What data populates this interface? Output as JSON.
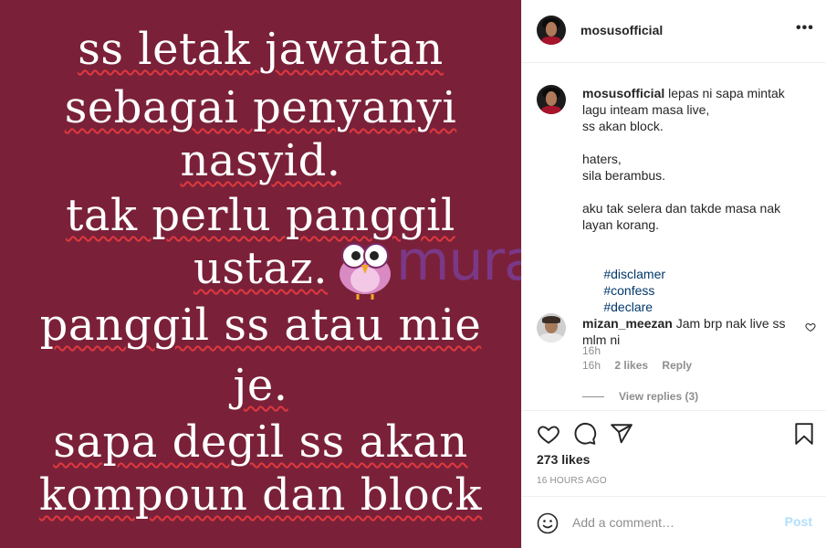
{
  "image": {
    "lines": [
      "ss letak jawatan",
      "sebagai penyanyi",
      "nasyid.",
      "tak perlu panggil",
      "ustaz.",
      "panggil ss atau mie",
      "je.",
      "sapa degil ss akan",
      "kompoun dan block"
    ],
    "background_color": "#7a2139",
    "watermark": "murai"
  },
  "header": {
    "username": "mosusofficial",
    "more_icon": "ellipsis-icon"
  },
  "caption": {
    "username": "mosusofficial",
    "text": "lepas ni sapa mintak lagu inteam masa live,\nss akan block.\n\nhaters,\nsila berambus.\n\naku tak selera dan takde masa nak layan korang.",
    "hashtags": [
      "#disclamer",
      "#confess",
      "#declare"
    ],
    "time": "16h"
  },
  "comment": {
    "username": "mizan_meezan",
    "text": "Jam brp nak live ss mlm ni",
    "time": "16h",
    "likes": "2 likes",
    "reply_label": "Reply",
    "view_replies": "View replies (3)"
  },
  "actions": {
    "likes": "273 likes",
    "posted": "16 HOURS AGO",
    "icons": [
      "heart-icon",
      "comment-icon",
      "share-icon",
      "bookmark-icon"
    ]
  },
  "add_comment": {
    "placeholder": "Add a comment…",
    "post_label": "Post"
  },
  "colors": {
    "hashtag": "#00376b",
    "post_disabled": "#b2dffc",
    "watermark": "#7b3a8c"
  }
}
